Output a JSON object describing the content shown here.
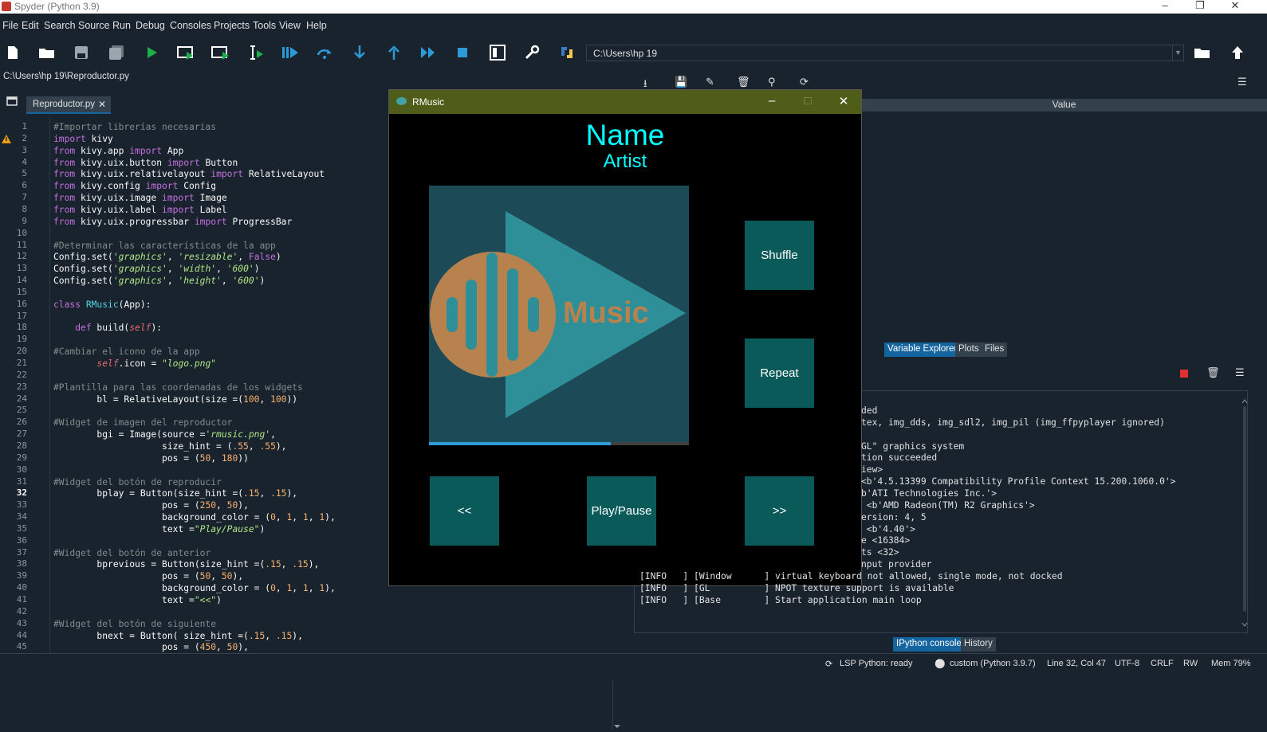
{
  "window": {
    "title": "Spyder (Python 3.9)"
  },
  "menu": [
    "File",
    "Edit",
    "Search",
    "Source",
    "Run",
    "Debug",
    "Consoles",
    "Projects",
    "Tools",
    "View",
    "Help"
  ],
  "toolbar": {
    "path": "C:\\Users\\hp 19"
  },
  "editor": {
    "file_path": "C:\\Users\\hp 19\\Reproductor.py",
    "tab_label": "Reproductor.py",
    "current_line": 32,
    "lines": [
      "#Importar librerías necesarias",
      "import kivy",
      "from kivy.app import App",
      "from kivy.uix.button import Button",
      "from kivy.uix.relativelayout import RelativeLayout",
      "from kivy.config import Config",
      "from kivy.uix.image import Image",
      "from kivy.uix.label import Label",
      "from kivy.uix.progressbar import ProgressBar",
      "",
      "#Determinar las características de la app",
      "Config.set('graphics', 'resizable', False)",
      "Config.set('graphics', 'width', '600')",
      "Config.set('graphics', 'height', '600')",
      "",
      "class RMusic(App):",
      "",
      "    def build(self):",
      "",
      "#Cambiar el icono de la app",
      "        self.icon = \"logo.png\"",
      "",
      "#Plantilla para las coordenadas de los widgets",
      "        bl = RelativeLayout(size =(100, 100))",
      "",
      "#Widget de imagen del reproductor",
      "        bgi = Image(source ='rmusic.png',",
      "                    size_hint = (.55, .55),",
      "                    pos = (50, 180))",
      "",
      "#Widget del botón de reproducir",
      "        bplay = Button(size_hint =(.15, .15),",
      "                    pos = (250, 50),",
      "                    background_color = (0, 1, 1, 1),",
      "                    text =\"Play/Pause\")",
      "",
      "#Widget del botón de anterior",
      "        bprevious = Button(size_hint =(.15, .15),",
      "                    pos = (50, 50),",
      "                    background_color = (0, 1, 1, 1),",
      "                    text =\"<<\")",
      "",
      "#Widget del botón de siguiente",
      "        bnext = Button( size_hint =(.15, .15),",
      "                    pos = (450, 50),"
    ]
  },
  "right_panel": {
    "value_header": "Value",
    "tabs_top": [
      "Variable Explorer",
      "Plots",
      "Files"
    ],
    "tabs_bottom": [
      "IPython console",
      "History"
    ]
  },
  "console": {
    "lines": [
      "ded",
      "tex, img_dds, img_sdl2, img_pil (img_ffpyplayer ignored)",
      "",
      "GL\" graphics system",
      "tion succeeded",
      "iew>",
      "<b'4.5.13399 Compatibility Profile Context 15.200.1060.0'>",
      "b'ATI Technologies Inc.'>",
      " <b'AMD Radeon(TM) R2 Graphics'>",
      "ersion: 4, 5",
      " <b'4.40'>",
      "e <16384>",
      "ts <32>",
      "nput provider",
      "[INFO   ] [Window      ] virtual keyboard not allowed, single mode, not docked",
      "[INFO   ] [GL          ] NPOT texture support is available",
      "[INFO   ] [Base        ] Start application main loop"
    ]
  },
  "statusbar": {
    "lsp": "LSP Python: ready",
    "env": "custom (Python 3.9.7)",
    "position": "Line 32, Col 47",
    "encoding": "UTF-8",
    "eol": "CRLF",
    "rw": "RW",
    "mem": "Mem 79%"
  },
  "kivy_app": {
    "title": "RMusic",
    "name": "Name",
    "artist": "Artist",
    "cover_text": "Music",
    "progress": 0.7,
    "buttons": {
      "shuffle": "Shuffle",
      "repeat": "Repeat",
      "prev": "<<",
      "play": "Play/Pause",
      "next": ">>"
    },
    "colors": {
      "title_bar": "#4e5e18",
      "text": "#00ffff",
      "button": "#0b5a5a"
    }
  }
}
